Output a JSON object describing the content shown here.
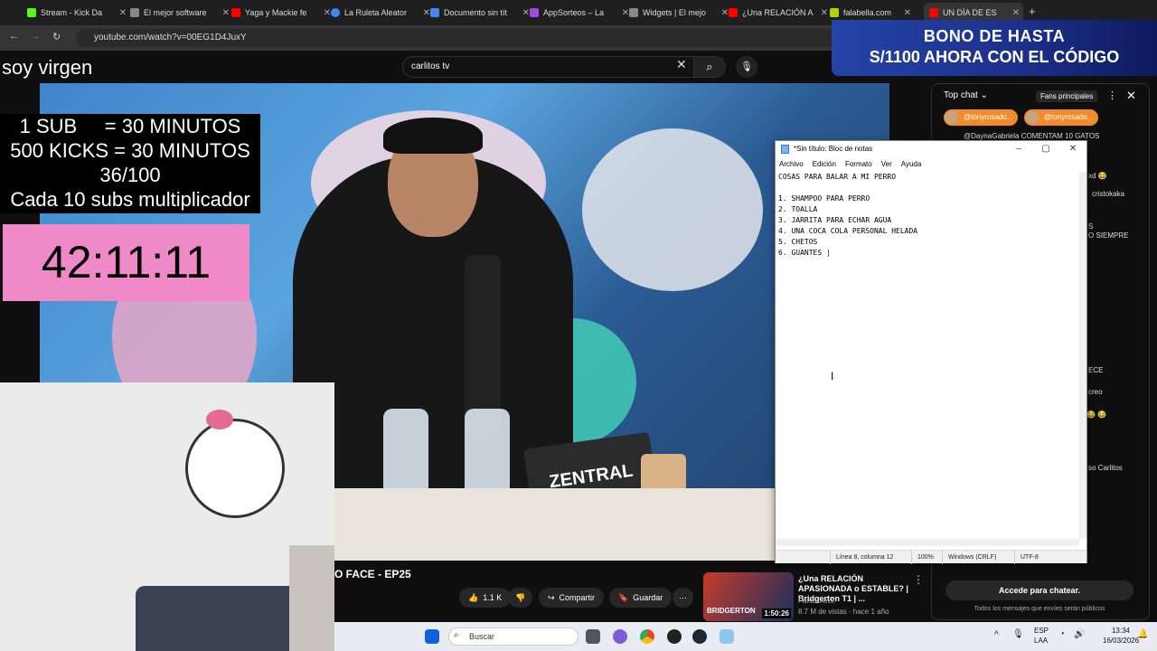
{
  "browser": {
    "tabs": [
      {
        "label": "Stream - Kick Da",
        "color": "#53fc18"
      },
      {
        "label": "El mejor software",
        "color": "#888888"
      },
      {
        "label": "Yaga y Mackie fe",
        "color": "#ff0000"
      },
      {
        "label": "La Ruleta Aleator",
        "color": "#4285f4"
      },
      {
        "label": "Documento sin tít",
        "color": "#4285f4"
      },
      {
        "label": "AppSorteos – La",
        "color": "#a347e0"
      },
      {
        "label": "Widgets | El mejo",
        "color": "#888888"
      },
      {
        "label": "¿Una RELACIÓN A",
        "color": "#ff0000"
      },
      {
        "label": "falabella.com",
        "color": "#a8d600"
      },
      {
        "label": "UN DÍA DE ES",
        "color": "#ff0000"
      }
    ],
    "url": "youtube.com/watch?v=00EG1D4JuxY"
  },
  "youtube": {
    "search_value": "carlitos tv",
    "video_title": "O FACE - EP25",
    "like_count": "1.1 K",
    "share_label": "Compartir",
    "save_label": "Guardar",
    "suggested": {
      "title": "¿Una RELACIÓN APASIONADA o ESTABLE? | Bridgerton T1 | ...",
      "channel": "Farid Dieck",
      "meta": "8.7 M de vistas · hace 1 año",
      "duration": "1:50:26",
      "thumb_text": "BRIDGERTON"
    }
  },
  "ad": {
    "line1": "BONO DE HASTA",
    "line2": "S/1100 AHORA CON EL CÓDIGO"
  },
  "overlay": {
    "top_text": "soy virgen",
    "rules": [
      "1 SUB     = 30 MINUTOS",
      "500 KICKS = 30 MINUTOS",
      "36/100",
      "Cada 10 subs multiplicador"
    ],
    "timer": "42:11:11"
  },
  "chat": {
    "title": "Top chat",
    "fans_label": "Fans principales",
    "donors": [
      "@tonyrosado...",
      "@tonyrosado..."
    ],
    "messages": [
      {
        "text": "@DaynaGabriela  COMENTAM 10 GATOS"
      },
      {
        "text": "xd 😂"
      },
      {
        "text": "cristokaka"
      },
      {
        "text": "S"
      },
      {
        "text": "O SIEMPRE"
      },
      {
        "text": "ECE"
      },
      {
        "text": "creo"
      },
      {
        "text": "😂 😂"
      },
      {
        "text": "so Carlitos"
      }
    ],
    "login_label": "Accede para chatear.",
    "note": "Todos los mensajes que envíes serán públicos"
  },
  "notepad": {
    "title": "*Sin título: Bloc de notas",
    "menu": [
      "Archivo",
      "Edición",
      "Formato",
      "Ver",
      "Ayuda"
    ],
    "content": "COSAS PARA BALAR A MI PERRO\n\n1. SHAMPOO PARA PERRO\n2. TOALLA\n3. JARRITA PARA ECHAR AGUA\n4. UNA COCA COLA PERSONAL HELADA\n5. CHETOS\n6. GUANTES |",
    "status": {
      "position": "Línea 8, columna 12",
      "zoom": "100%",
      "eol": "Windows (CRLF)",
      "encoding": "UTF-8"
    }
  },
  "taskbar": {
    "search_placeholder": "Buscar",
    "lang": [
      "ESP",
      "LAA"
    ],
    "time": "13:34",
    "date": "16/03/2026"
  }
}
